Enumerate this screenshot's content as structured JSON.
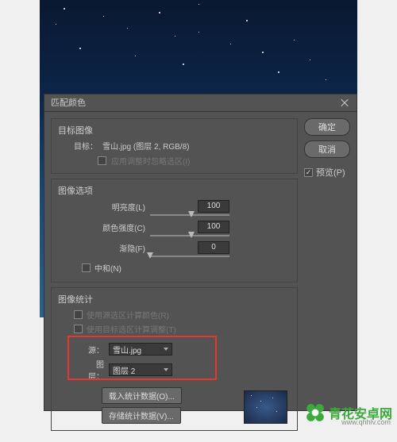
{
  "dialog": {
    "title": "匹配颜色",
    "target": {
      "group_title": "目标图像",
      "label": "目标：",
      "value": "雪山.jpg (图层 2, RGB/8)",
      "ignore_selection": "应用调整时忽略选区(I)"
    },
    "options": {
      "group_title": "图像选项",
      "luminance": {
        "label": "明亮度(L)",
        "value": "100"
      },
      "intensity": {
        "label": "颜色强度(C)",
        "value": "100"
      },
      "fade": {
        "label": "渐隐(F)",
        "value": "0"
      },
      "neutralize": "中和(N)"
    },
    "stats": {
      "group_title": "图像统计",
      "use_source_selection": "使用源选区计算颜色(R)",
      "use_target_selection": "使用目标选区计算调整(T)",
      "source_label": "源：",
      "source_value": "雪山.jpg",
      "layer_label": "图层：",
      "layer_value": "图层 2",
      "load_btn": "载入统计数据(O)...",
      "save_btn": "存储统计数据(V)..."
    },
    "buttons": {
      "ok": "确定",
      "cancel": "取消"
    },
    "preview": "预览(P)"
  },
  "watermark": {
    "text": "青花安卓网",
    "url": "www.qhhlv.com"
  }
}
